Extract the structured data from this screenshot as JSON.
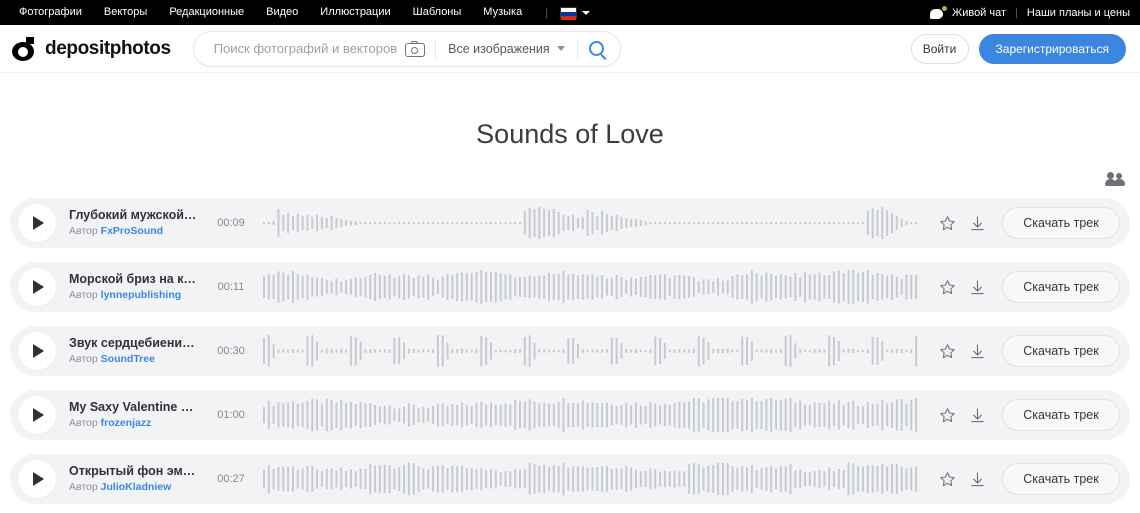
{
  "topbar": {
    "nav_items": [
      {
        "label": "Фотографии"
      },
      {
        "label": "Векторы"
      },
      {
        "label": "Редакционные"
      },
      {
        "label": "Видео"
      },
      {
        "label": "Иллюстрации"
      },
      {
        "label": "Шаблоны"
      },
      {
        "label": "Музыка"
      }
    ],
    "separator": "|",
    "language": "RU",
    "live_chat_label": "Живой чат",
    "right_separator": "|",
    "plans_label": "Наши планы и цены"
  },
  "header": {
    "logo_text": "depositphotos",
    "search": {
      "placeholder": "Поиск фотографий и векторов",
      "value": "",
      "filter_label": "Все изображения"
    },
    "login_label": "Войти",
    "signup_label": "Зарегистрироваться"
  },
  "page": {
    "title": "Sounds of Love",
    "contributor_icon": "people-icon"
  },
  "tracks": {
    "author_prefix": "Автор",
    "download_label": "Скачать трек",
    "items": [
      {
        "title": "Глубокий мужской г…",
        "author": "FxProSound",
        "duration": "00:09",
        "waveform": "sparse-bursts"
      },
      {
        "title": "Морской бриз на коже",
        "author": "lynnepublishing",
        "duration": "00:11",
        "waveform": "dense-even"
      },
      {
        "title": "Звук сердцебиения …",
        "author": "SoundTree",
        "duration": "00:30",
        "waveform": "rhythmic-pulse"
      },
      {
        "title": "My Saxy Valentine S…",
        "author": "frozenjazz",
        "duration": "01:00",
        "waveform": "dense-varied"
      },
      {
        "title": "Открытый фон эмоц…",
        "author": "JulioKladniew",
        "duration": "00:27",
        "waveform": "dense-blocks"
      }
    ]
  },
  "colors": {
    "accent_blue": "#3b86e0",
    "topbar_black": "#000000",
    "row_gray": "#f2f3f5",
    "wave_gray": "#c6c9ce",
    "online_green": "#8cc63f"
  }
}
